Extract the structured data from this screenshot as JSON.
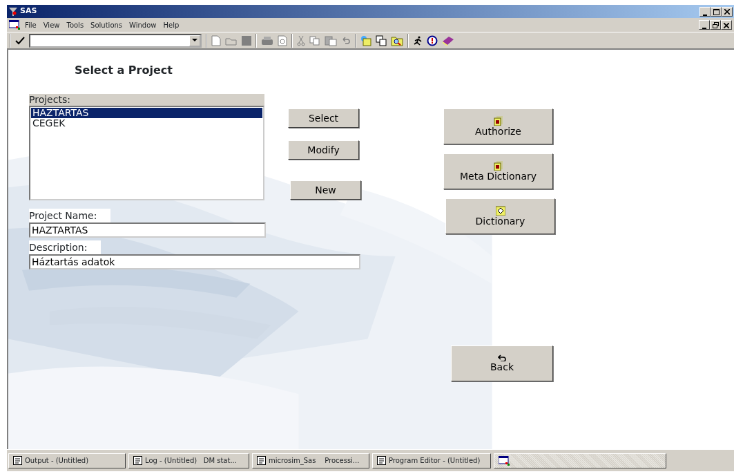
{
  "window": {
    "title": "SAS"
  },
  "menu": [
    "File",
    "View",
    "Tools",
    "Solutions",
    "Window",
    "Help"
  ],
  "form": {
    "title": "Select a Project",
    "projects_label": "Projects:",
    "projects": [
      {
        "label": "HAZTARTAS",
        "selected": true
      },
      {
        "label": "CEGEK",
        "selected": false
      }
    ],
    "list_buttons": [
      "Select",
      "Modify",
      "New"
    ],
    "project_name": {
      "label": "Project Name:",
      "value": "HAZTARTAS"
    },
    "description": {
      "label": "Description:",
      "value": "Háztartás adatok"
    },
    "side_buttons": [
      {
        "label": "Authorize",
        "kind": "cabinet"
      },
      {
        "label": "Meta Dictionary",
        "kind": "cabinet"
      },
      {
        "label": "Dictionary",
        "kind": "book"
      }
    ],
    "back_button": "Back"
  },
  "taskbar": [
    "Output - (Untitled)",
    "Log - (Untitled)   DM stat...",
    "microsim_Sas    Processi...",
    "Program Editor - (Untitled)"
  ]
}
